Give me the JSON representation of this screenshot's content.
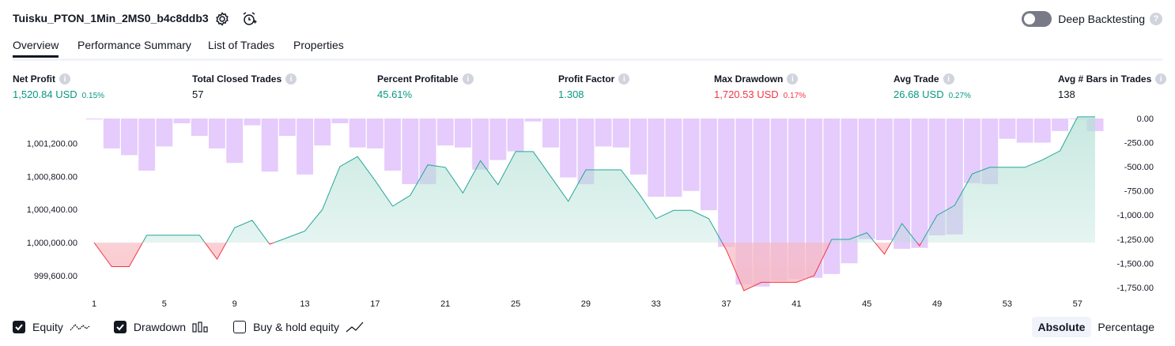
{
  "header": {
    "title": "Tuisku_PTON_1Min_2MS0_b4c8ddb3",
    "deep_backtesting_label": "Deep Backtesting",
    "deep_backtesting_enabled": false
  },
  "tabs": [
    {
      "label": "Overview",
      "active": true
    },
    {
      "label": "Performance Summary",
      "active": false
    },
    {
      "label": "List of Trades",
      "active": false
    },
    {
      "label": "Properties",
      "active": false
    }
  ],
  "metrics": [
    {
      "label": "Net Profit",
      "value": "1,520.84 USD",
      "pct": "0.15%",
      "tone": "pos"
    },
    {
      "label": "Total Closed Trades",
      "value": "57",
      "pct": "",
      "tone": "plain"
    },
    {
      "label": "Percent Profitable",
      "value": "45.61%",
      "pct": "",
      "tone": "pos"
    },
    {
      "label": "Profit Factor",
      "value": "1.308",
      "pct": "",
      "tone": "pos"
    },
    {
      "label": "Max Drawdown",
      "value": "1,720.53 USD",
      "pct": "0.17%",
      "tone": "neg"
    },
    {
      "label": "Avg Trade",
      "value": "26.68 USD",
      "pct": "0.27%",
      "tone": "pos"
    },
    {
      "label": "Avg # Bars in Trades",
      "value": "138",
      "pct": "",
      "tone": "plain"
    }
  ],
  "legend": {
    "equity_label": "Equity",
    "equity_checked": true,
    "drawdown_label": "Drawdown",
    "drawdown_checked": true,
    "buyhold_label": "Buy & hold equity",
    "buyhold_checked": false
  },
  "scale_buttons": {
    "absolute": "Absolute",
    "percentage": "Percentage",
    "active": "absolute"
  },
  "colors": {
    "equity_line": "#26a69a",
    "equity_fill": "#b2e0d4",
    "loss_line": "#f23645",
    "loss_fill": "#f7b8bf",
    "drawdown_bar": "#e1c3fb"
  },
  "chart_data": {
    "type": "line",
    "baseline": 1000000,
    "x_ticks": [
      1,
      5,
      9,
      13,
      17,
      21,
      25,
      29,
      33,
      37,
      41,
      45,
      49,
      53,
      57
    ],
    "left_axis": {
      "ticks": [
        "999,600.00",
        "1,000,000.00",
        "1,000,400.00",
        "1,000,800.00",
        "1,001,200.00"
      ],
      "tick_values": [
        999600,
        1000000,
        1000400,
        1000800,
        1001200
      ],
      "range": [
        999400,
        1001500
      ]
    },
    "right_axis": {
      "ticks": [
        "0.00",
        "-250.00",
        "-500.00",
        "-750.00",
        "-1,000.00",
        "-1,250.00",
        "-1,500.00",
        "-1,750.00"
      ],
      "tick_values": [
        0,
        -250,
        -500,
        -750,
        -1000,
        -1250,
        -1500,
        -1750
      ],
      "range": [
        -1800,
        0
      ]
    },
    "series": [
      {
        "name": "Equity",
        "x": [
          1,
          2,
          3,
          4,
          5,
          6,
          7,
          8,
          9,
          10,
          11,
          12,
          13,
          14,
          15,
          16,
          17,
          18,
          19,
          20,
          21,
          22,
          23,
          24,
          25,
          26,
          27,
          28,
          29,
          30,
          31,
          32,
          33,
          34,
          35,
          36,
          37,
          38,
          39,
          40,
          41,
          42,
          43,
          44,
          45,
          46,
          47,
          48,
          49,
          50,
          51,
          52,
          53,
          54,
          55,
          56,
          57,
          58
        ],
        "values": [
          1000000,
          999710,
          999710,
          1000090,
          1000090,
          1000090,
          1000090,
          999800,
          1000180,
          1000270,
          999980,
          1000060,
          1000140,
          1000400,
          1000920,
          1001040,
          1000750,
          1000440,
          1000570,
          1000940,
          1000910,
          1000600,
          1000990,
          1000700,
          1001100,
          1001100,
          1000800,
          1000500,
          1000880,
          1000880,
          1000880,
          1000600,
          1000290,
          1000390,
          1000390,
          1000290,
          999910,
          999420,
          999520,
          999520,
          999520,
          999600,
          1000040,
          1000040,
          1000120,
          999860,
          1000230,
          999960,
          1000330,
          1000450,
          1000830,
          1000910,
          1000910,
          1000910,
          1001000,
          1001110,
          1001520,
          1001520
        ]
      },
      {
        "name": "Drawdown",
        "x": [
          1,
          2,
          3,
          4,
          5,
          6,
          7,
          8,
          9,
          10,
          11,
          12,
          13,
          14,
          15,
          16,
          17,
          18,
          19,
          20,
          21,
          22,
          23,
          24,
          25,
          26,
          27,
          28,
          29,
          30,
          31,
          32,
          33,
          34,
          35,
          36,
          37,
          38,
          39,
          40,
          41,
          42,
          43,
          44,
          45,
          46,
          47,
          48,
          49,
          50,
          51,
          52,
          53,
          54,
          55,
          56,
          57,
          58
        ],
        "values": [
          -10,
          -310,
          -380,
          -540,
          -290,
          -50,
          -180,
          -310,
          -460,
          -70,
          -550,
          -180,
          -580,
          -280,
          -50,
          -300,
          -310,
          -540,
          -680,
          -680,
          -280,
          -300,
          -530,
          -430,
          -340,
          -30,
          -300,
          -610,
          -680,
          -290,
          -300,
          -580,
          -810,
          -810,
          -750,
          -950,
          -1330,
          -1720,
          -1740,
          -1680,
          -1660,
          -1650,
          -1610,
          -1500,
          -1250,
          -1260,
          -1350,
          -1340,
          -1210,
          -1200,
          -670,
          -680,
          -210,
          -250,
          -250,
          -130,
          0,
          -130
        ]
      }
    ]
  }
}
